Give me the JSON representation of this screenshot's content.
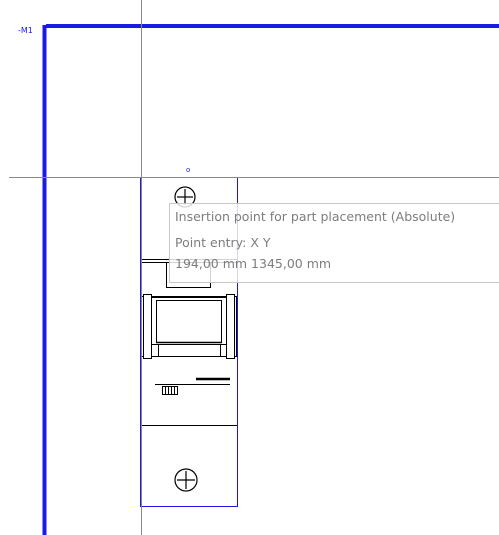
{
  "canvas": {
    "part_label": "-M1",
    "origin_marker": "o",
    "colors": {
      "accent": "#1a1ae6",
      "crosshair": "#808080",
      "tooltip_text": "#7d7d7d",
      "part_stroke": "#000000"
    }
  },
  "tooltip": {
    "title": "Insertion point for part placement (Absolute)",
    "entry_mode": "Point entry: X Y",
    "coordinates": "194,00 mm  1345,00 mm"
  },
  "icons": [
    "screw-terminal-icon",
    "crosshair-cursor-icon"
  ]
}
